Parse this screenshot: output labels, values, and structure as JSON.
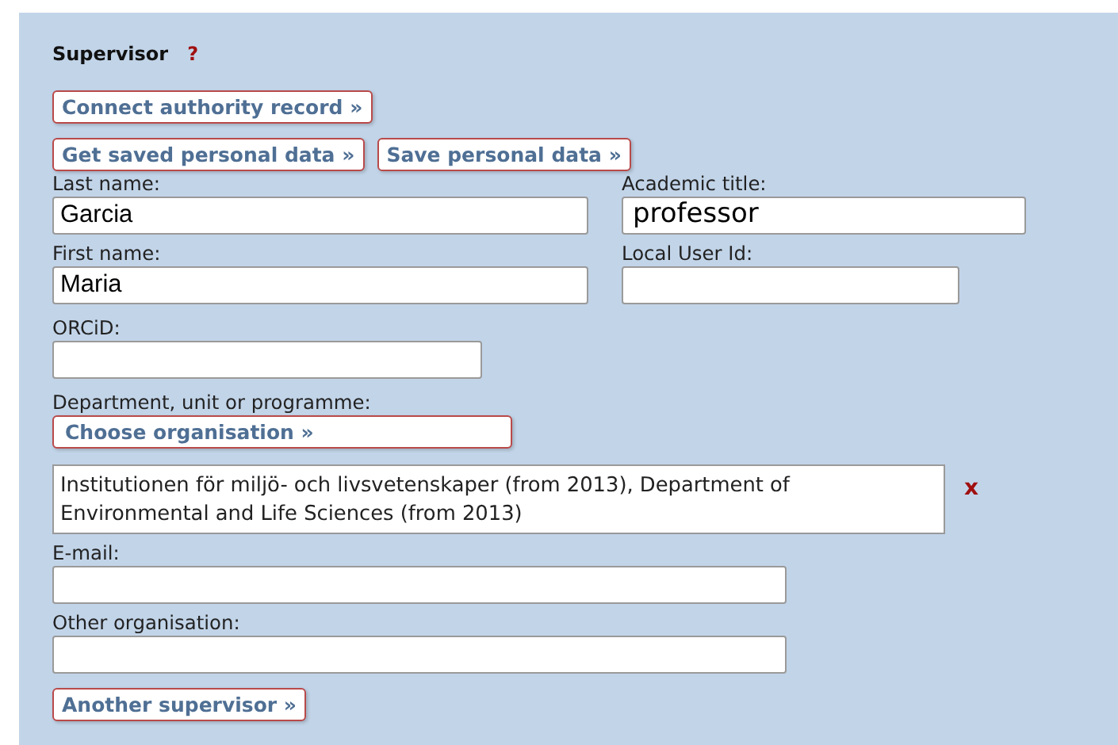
{
  "section": {
    "title": "Supervisor",
    "help": "?"
  },
  "authority_button": "Connect authority record »",
  "personal_buttons": [
    "Get saved personal data »",
    "Save personal data »"
  ],
  "name_rows": [
    [
      {
        "label": "Last name:",
        "value": "Garcia"
      },
      {
        "label": "Academic title:",
        "value": "professor"
      }
    ],
    [
      {
        "label": "First name:",
        "value": "Maria"
      },
      {
        "label": "Local User Id:"
      }
    ]
  ],
  "orcid": {
    "label": "ORCiD:"
  },
  "department": {
    "label": "Department, unit or programme:",
    "button": "Choose organisation »",
    "selected": "Institutionen för miljö- och livsvetenskaper (from 2013), Department of Environmental and Life Sciences (from 2013)",
    "remove": "x"
  },
  "email": {
    "label": "E-mail:"
  },
  "other_organisation": {
    "label": "Other organisation:"
  },
  "another_button": "Another supervisor »"
}
